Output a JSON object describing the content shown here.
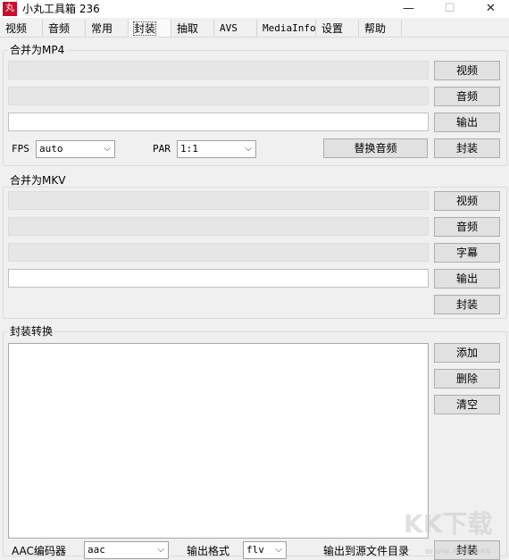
{
  "window": {
    "icon_glyph": "丸",
    "title": "小丸工具箱 236",
    "controls": {
      "minimize": "—",
      "maximize": "☐",
      "close": "✕"
    }
  },
  "tabs": [
    {
      "label": "视频"
    },
    {
      "label": "音频"
    },
    {
      "label": "常用"
    },
    {
      "label": "封装",
      "active": true
    },
    {
      "label": "抽取"
    },
    {
      "label": "AVS"
    },
    {
      "label": "MediaInfo"
    },
    {
      "label": "设置"
    },
    {
      "label": "帮助"
    }
  ],
  "mp4": {
    "group_label": "合并为MP4",
    "video_button": "视频",
    "audio_button": "音频",
    "output_button": "输出",
    "mux_button": "封装",
    "video_path": "",
    "audio_path": "",
    "output_path": "",
    "fps_label": "FPS",
    "fps_value": "auto",
    "par_label": "PAR",
    "par_value": "1:1",
    "replace_audio_button": "替换音频"
  },
  "mkv": {
    "group_label": "合并为MKV",
    "video_button": "视频",
    "audio_button": "音频",
    "subtitle_button": "字幕",
    "output_button": "输出",
    "mux_button": "封装",
    "video_path": "",
    "audio_path": "",
    "subtitle_path": "",
    "output_path": ""
  },
  "convert": {
    "group_label": "封装转换",
    "add_button": "添加",
    "delete_button": "删除",
    "clear_button": "清空",
    "aac_encoder_label": "AAC编码器",
    "aac_encoder_value": "aac",
    "output_format_label": "输出格式",
    "output_format_value": "flv",
    "output_to_source_label": "输出到源文件目录",
    "mux_button": "封装"
  },
  "watermark": {
    "logo": "KK下载",
    "url": "www.kkx.net"
  },
  "colors": {
    "app_icon": "#c8102e",
    "window_bg": "#f0f0f0",
    "button_bg": "#e1e1e1",
    "disabled_field": "#e6e6e6"
  }
}
